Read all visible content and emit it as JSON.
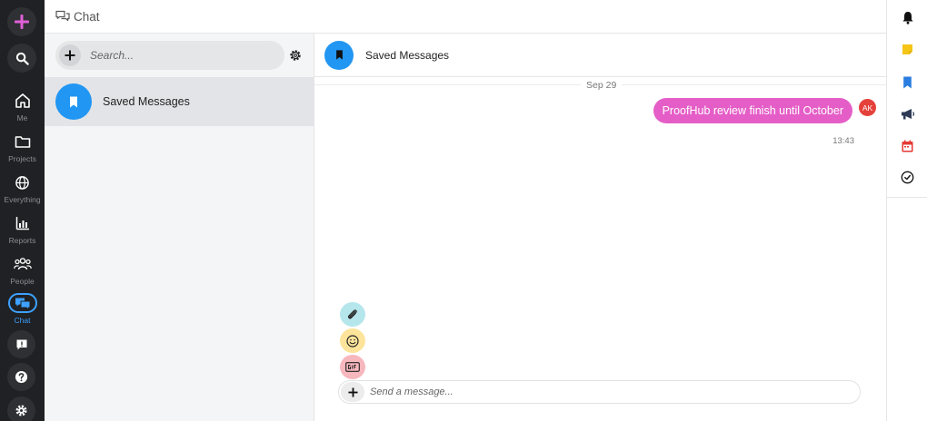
{
  "nav": {
    "items": [
      {
        "label": "Me"
      },
      {
        "label": "Projects"
      },
      {
        "label": "Everything"
      },
      {
        "label": "Reports"
      },
      {
        "label": "People"
      },
      {
        "label": "Chat"
      }
    ]
  },
  "header": {
    "title": "Chat"
  },
  "sidebar": {
    "search_placeholder": "Search...",
    "conversations": [
      {
        "name": "Saved Messages"
      }
    ]
  },
  "chat": {
    "title": "Saved Messages",
    "date_label": "Sep 29",
    "messages": [
      {
        "text": "ProofHub review finish until October",
        "time": "13:43",
        "author_initials": "AK"
      }
    ],
    "composer_placeholder": "Send a message..."
  },
  "colors": {
    "accent": "#2196f3",
    "bubble": "#e55ec7",
    "brand_plus": "#e05fd6",
    "nav_bg": "#1f2124"
  }
}
